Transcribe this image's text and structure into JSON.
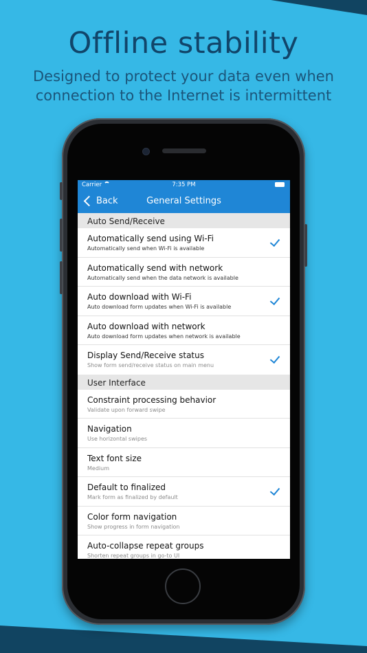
{
  "banner": {
    "title": "Offline stability",
    "subtitle_line1": "Designed to protect your data even when",
    "subtitle_line2": "connection to the Internet is intermittent"
  },
  "status_bar": {
    "carrier": "Carrier",
    "time": "7:35 PM",
    "icons": [
      "wifi-icon",
      "battery-icon"
    ]
  },
  "nav": {
    "back_label": "Back",
    "title": "General Settings",
    "icon": "chevron-left-icon"
  },
  "colors": {
    "background": "#36b8e6",
    "accent": "#1f86d6",
    "dark_navy": "#114461"
  },
  "sections": [
    {
      "header": "Auto Send/Receive",
      "items": [
        {
          "title": "Automatically send using Wi-Fi",
          "subtitle": "Automatically send when Wi-Fi is available",
          "checked": "true"
        },
        {
          "title": "Automatically send with network",
          "subtitle": "Automatically send when the data network is available",
          "checked": "false"
        },
        {
          "title": "Auto download with Wi-Fi",
          "subtitle": "Auto download form updates when Wi-Fi is available",
          "checked": "true"
        },
        {
          "title": "Auto download with network",
          "subtitle": "Auto download form updates when network is available",
          "checked": "false"
        },
        {
          "title": "Display Send/Receive status",
          "subtitle": "Show form send/receive status on main menu",
          "checked": "true"
        }
      ]
    },
    {
      "header": "User Interface",
      "items": [
        {
          "title": "Constraint processing behavior",
          "subtitle": "Validate upon forward swipe",
          "checked": "false"
        },
        {
          "title": "Navigation",
          "subtitle": "Use horizontal swipes",
          "checked": "false"
        },
        {
          "title": "Text font size",
          "subtitle": "Medium",
          "checked": "false"
        },
        {
          "title": "Default to finalized",
          "subtitle": "Mark form as finalized by default",
          "checked": "true"
        },
        {
          "title": "Color form navigation",
          "subtitle": "Show progress in form navigation",
          "checked": "false"
        },
        {
          "title": "Auto-collapse repeat groups",
          "subtitle": "Shorten repeat groups in go-to UI",
          "checked": "false"
        }
      ]
    }
  ]
}
